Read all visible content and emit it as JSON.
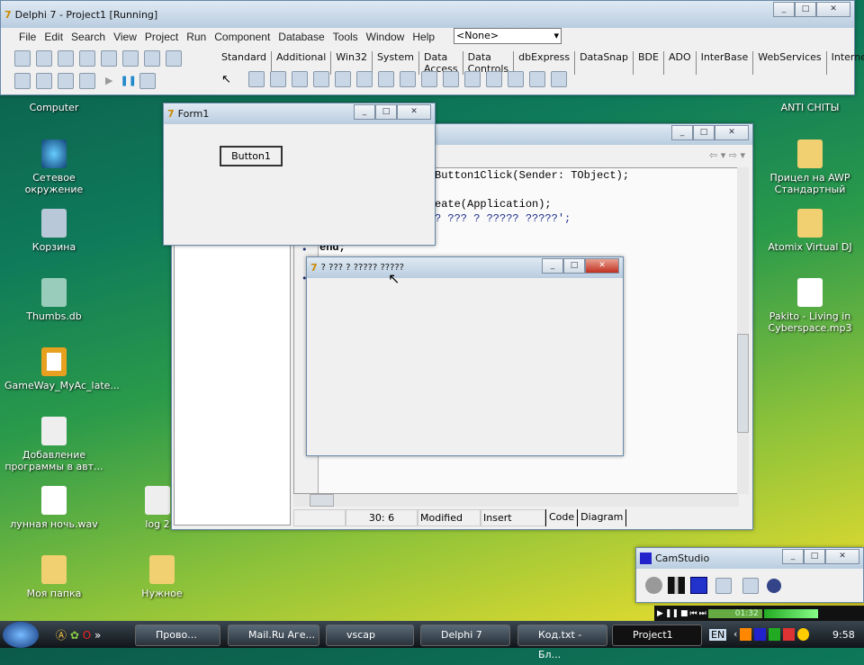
{
  "desktop": {
    "left_icons": [
      "Computer",
      "Сетевое окружение",
      "Корзина",
      "Thumbs.db",
      "GameWay_MyAc_late...",
      "Добавление программы в авт...",
      "лунная ночь.wav",
      "Моя папка"
    ],
    "mid_icons": [
      "log 2",
      "Нужное"
    ],
    "right_icons": [
      "ANTI CHITЫ",
      "Прицел на AWP Стандартный",
      "Atomix Virtual DJ",
      "Pakito - Living in Cyberspace.mp3"
    ]
  },
  "delphi": {
    "title": "Delphi 7 - Project1 [Running]",
    "menu": [
      "File",
      "Edit",
      "Search",
      "View",
      "Project",
      "Run",
      "Component",
      "Database",
      "Tools",
      "Window",
      "Help"
    ],
    "combo_value": "<None>",
    "palette_tabs": [
      "Standard",
      "Additional",
      "Win32",
      "System",
      "Data Access",
      "Data Controls",
      "dbExpress",
      "DataSnap",
      "BDE",
      "ADO",
      "InterBase",
      "WebServices",
      "Internet"
    ]
  },
  "editor": {
    "code_lines": [
      "Button1Click(Sender: TObject);",
      "eate(Application);",
      "? ??? ? ????? ?????';",
      "end;"
    ],
    "status": {
      "position": "30:  6",
      "modified": "Modified",
      "mode": "Insert"
    },
    "tabs": [
      "Code",
      "Diagram"
    ]
  },
  "form1": {
    "title": "Form1",
    "button": "Button1"
  },
  "dialog": {
    "title": "? ??? ? ????? ?????"
  },
  "camstudio": {
    "title": "CamStudio",
    "timer": "01:32"
  },
  "taskbar": {
    "items": [
      "Прово...",
      "Mail.Ru Аге...",
      "vscap",
      "Delphi 7",
      "Код.txt - Бл...",
      "Project1"
    ],
    "lang": "EN",
    "clock": "9:58"
  }
}
